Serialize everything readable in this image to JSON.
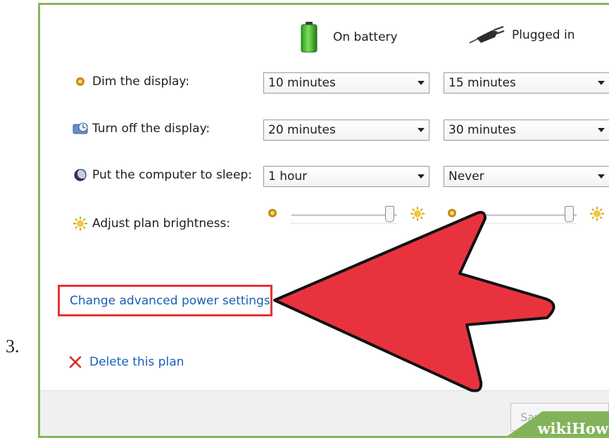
{
  "step": "3.",
  "columns": {
    "on_battery": "On battery",
    "plugged_in": "Plugged in"
  },
  "rows": [
    {
      "label": "Dim the display:",
      "icon": "dim-display-icon",
      "battery": "10 minutes",
      "plugged": "15 minutes"
    },
    {
      "label": "Turn off the display:",
      "icon": "monitor-icon",
      "battery": "20 minutes",
      "plugged": "30 minutes"
    },
    {
      "label": "Put the computer to sleep:",
      "icon": "sleep-moon-icon",
      "battery": "1 hour",
      "plugged": "Never"
    }
  ],
  "brightness": {
    "label": "Adjust plan brightness:",
    "battery_level": 0.97,
    "plugged_level": 0.97
  },
  "links": {
    "advanced": "Change advanced power settings",
    "delete": "Delete this plan"
  },
  "buttons": {
    "save": "Save changes"
  },
  "watermark": "wikiHow",
  "colors": {
    "link": "#1a5fb4",
    "highlight_box": "#e23636",
    "arrow_fill": "#e8333f",
    "frame": "#86b85a"
  }
}
